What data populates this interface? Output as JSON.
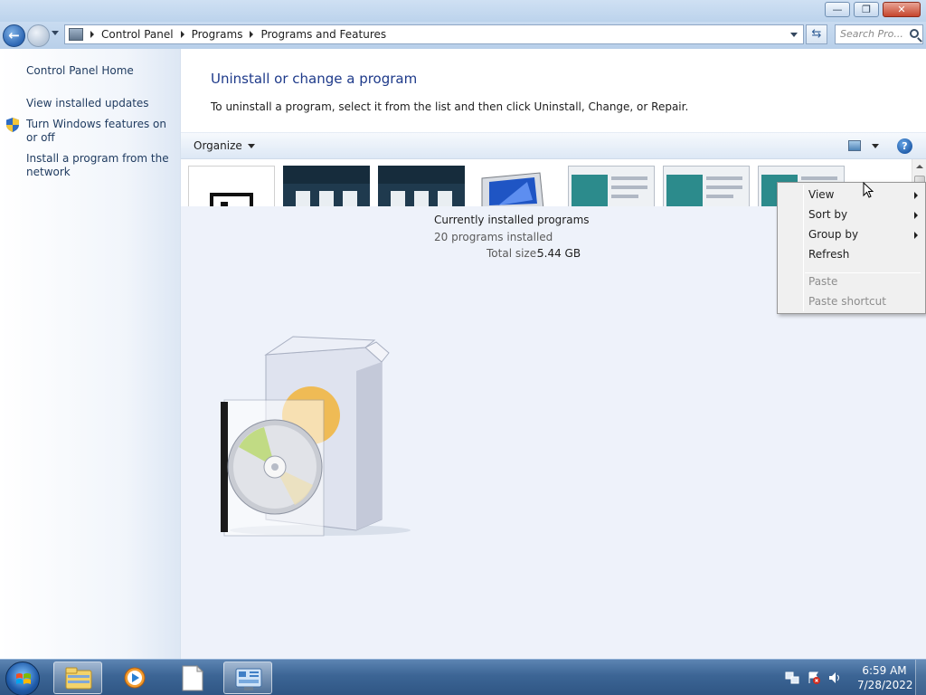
{
  "window": {
    "controls": {
      "minimize": "—",
      "restore": "❐",
      "close": "✕"
    }
  },
  "navbar": {
    "breadcrumbs": [
      "Control Panel",
      "Programs",
      "Programs and Features"
    ],
    "search_placeholder": "Search Pro..."
  },
  "sidebar": {
    "items": [
      {
        "label": "Control Panel Home"
      },
      {
        "label": "View installed updates"
      },
      {
        "label": "Turn Windows features on or off",
        "icon": "shield-icon"
      },
      {
        "label": "Install a program from the network"
      }
    ]
  },
  "main": {
    "heading": "Uninstall or change a program",
    "description": "To uninstall a program, select it from the list and then click Uninstall, Change, or Repair.",
    "toolbar": {
      "organize_label": "Organize",
      "help_label": "?"
    },
    "details": {
      "title": "Currently installed programs",
      "count": "20 programs installed",
      "size_label": "Total size:",
      "size_value": "5.44 GB"
    }
  },
  "context_menu": {
    "items": [
      {
        "label": "View",
        "submenu": true,
        "enabled": true
      },
      {
        "label": "Sort by",
        "submenu": true,
        "enabled": true
      },
      {
        "label": "Group by",
        "submenu": true,
        "enabled": true
      },
      {
        "label": "Refresh",
        "submenu": false,
        "enabled": true
      },
      {
        "label": "Paste",
        "submenu": false,
        "enabled": false
      },
      {
        "label": "Paste shortcut",
        "submenu": false,
        "enabled": false
      }
    ]
  },
  "taskbar": {
    "buttons": [
      "explorer-icon",
      "media-player-icon",
      "document-icon",
      "control-panel-icon"
    ],
    "clock": {
      "time": "6:59 AM",
      "date": "7/28/2022"
    }
  }
}
